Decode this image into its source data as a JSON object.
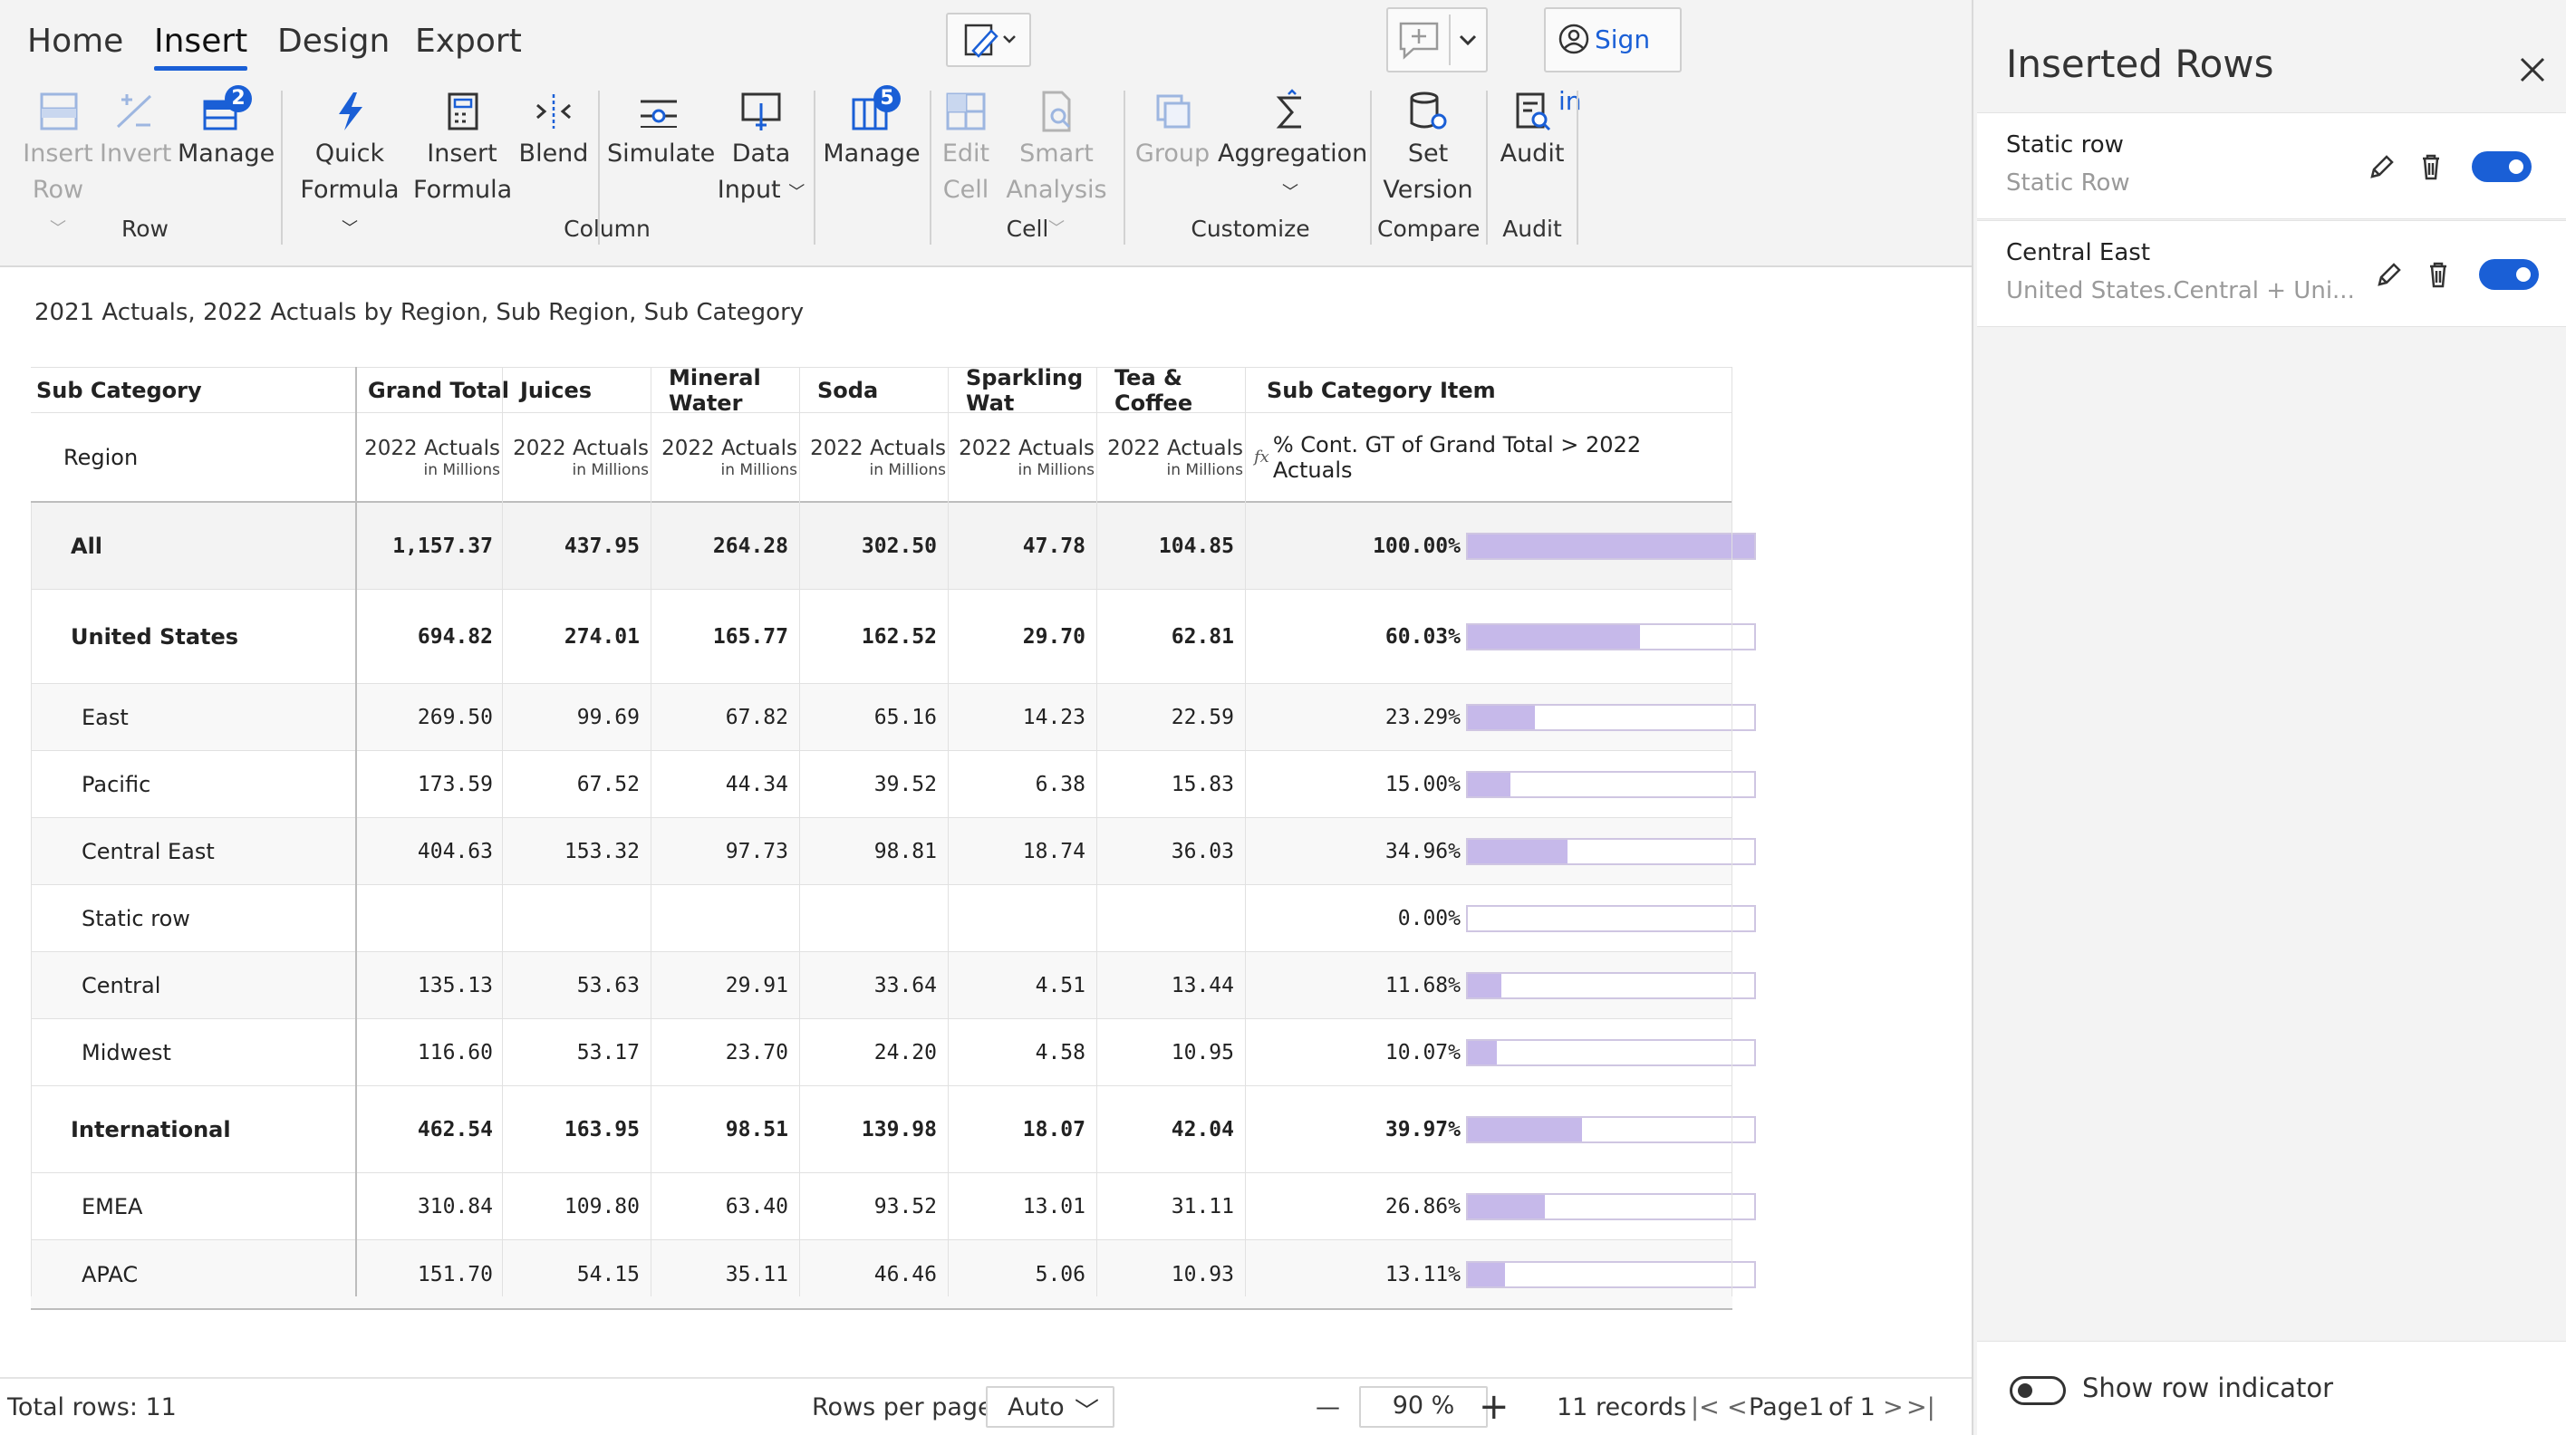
{
  "ribbon": {
    "tabs": [
      {
        "label": "Home",
        "active": false
      },
      {
        "label": "Insert",
        "active": true
      },
      {
        "label": "Design",
        "active": false
      },
      {
        "label": "Export",
        "active": false
      }
    ],
    "sign_in": "Sign in",
    "buttons": {
      "insert_row": [
        "Insert",
        "Row"
      ],
      "invert": "Invert",
      "manage_row": "Manage",
      "manage_row_badge": "2",
      "quick_formula": [
        "Quick",
        "Formula"
      ],
      "insert_formula": [
        "Insert",
        "Formula"
      ],
      "blend": "Blend",
      "simulate": "Simulate",
      "data_input": [
        "Data",
        "Input"
      ],
      "manage_col": "Manage",
      "manage_col_badge": "5",
      "edit_cell": [
        "Edit",
        "Cell"
      ],
      "smart_analysis": [
        "Smart",
        "Analysis"
      ],
      "group": "Group",
      "aggregation": "Aggregation",
      "set_version": [
        "Set",
        "Version"
      ],
      "audit": "Audit"
    },
    "groups": {
      "row": "Row",
      "column": "Column",
      "cell": "Cell",
      "customize": "Customize",
      "compare": "Compare",
      "audit": "Audit"
    }
  },
  "report": {
    "title": "2021 Actuals, 2022 Actuals by Region, Sub Region, Sub Category",
    "header": {
      "sub_category": "Sub Category",
      "region": "Region",
      "columns": [
        "Grand Total",
        "Juices",
        "Mineral Water",
        "Soda",
        "Sparkling Wat",
        "Tea & Coffee"
      ],
      "sub_category_item": "Sub Category Item",
      "measure": "2022 Actuals",
      "unit": "in Millions",
      "fx": "fx",
      "pct_label": "% Cont. GT of Grand Total > 2022 Actuals"
    },
    "rows": [
      {
        "label": "All",
        "level": 0,
        "bold": true,
        "values": [
          "1,157.37",
          "437.95",
          "264.28",
          "302.50",
          "47.78",
          "104.85"
        ],
        "pct": "100.00%",
        "fraction": 1.0
      },
      {
        "label": "United States",
        "level": 0,
        "bold": true,
        "values": [
          "694.82",
          "274.01",
          "165.77",
          "162.52",
          "29.70",
          "62.81"
        ],
        "pct": "60.03%",
        "fraction": 0.6003
      },
      {
        "label": "East",
        "level": 1,
        "bold": false,
        "values": [
          "269.50",
          "99.69",
          "67.82",
          "65.16",
          "14.23",
          "22.59"
        ],
        "pct": "23.29%",
        "fraction": 0.2329
      },
      {
        "label": "Pacific",
        "level": 1,
        "bold": false,
        "values": [
          "173.59",
          "67.52",
          "44.34",
          "39.52",
          "6.38",
          "15.83"
        ],
        "pct": "15.00%",
        "fraction": 0.15
      },
      {
        "label": "Central East",
        "level": 1,
        "bold": false,
        "values": [
          "404.63",
          "153.32",
          "97.73",
          "98.81",
          "18.74",
          "36.03"
        ],
        "pct": "34.96%",
        "fraction": 0.3496
      },
      {
        "label": "Static row",
        "level": 1,
        "bold": false,
        "values": [
          "",
          "",
          "",
          "",
          "",
          ""
        ],
        "pct": "0.00%",
        "fraction": 0.0
      },
      {
        "label": "Central",
        "level": 1,
        "bold": false,
        "values": [
          "135.13",
          "53.63",
          "29.91",
          "33.64",
          "4.51",
          "13.44"
        ],
        "pct": "11.68%",
        "fraction": 0.1168
      },
      {
        "label": "Midwest",
        "level": 1,
        "bold": false,
        "values": [
          "116.60",
          "53.17",
          "23.70",
          "24.20",
          "4.58",
          "10.95"
        ],
        "pct": "10.07%",
        "fraction": 0.1007
      },
      {
        "label": "International",
        "level": 0,
        "bold": true,
        "values": [
          "462.54",
          "163.95",
          "98.51",
          "139.98",
          "18.07",
          "42.04"
        ],
        "pct": "39.97%",
        "fraction": 0.3997
      },
      {
        "label": "EMEA",
        "level": 1,
        "bold": false,
        "values": [
          "310.84",
          "109.80",
          "63.40",
          "93.52",
          "13.01",
          "31.11"
        ],
        "pct": "26.86%",
        "fraction": 0.2686
      },
      {
        "label": "APAC",
        "level": 1,
        "bold": false,
        "values": [
          "151.70",
          "54.15",
          "35.11",
          "46.46",
          "5.06",
          "10.93"
        ],
        "pct": "13.11%",
        "fraction": 0.1311
      }
    ]
  },
  "footer": {
    "total_rows": "Total rows: 11",
    "rows_per_page_label": "Rows per page:",
    "rows_per_page_value": "Auto",
    "zoom_minus": "—",
    "zoom_value": "90 %",
    "zoom_plus": "+",
    "records": "11 records",
    "page_label": "Page",
    "page_number": "1",
    "page_of": "of 1"
  },
  "panel": {
    "title": "Inserted Rows",
    "items": [
      {
        "title": "Static row",
        "subtitle": "Static Row",
        "enabled": true
      },
      {
        "title": "Central East",
        "subtitle": "United States.Central + Uni...",
        "enabled": true
      }
    ],
    "show_row_indicator": "Show row indicator",
    "show_row_indicator_on": false
  },
  "colors": {
    "accent": "#1a5fd6",
    "bar_fill": "#c6b9ea",
    "bar_border": "#cfc6e2",
    "ribbon_bg": "#f3f3f3"
  }
}
